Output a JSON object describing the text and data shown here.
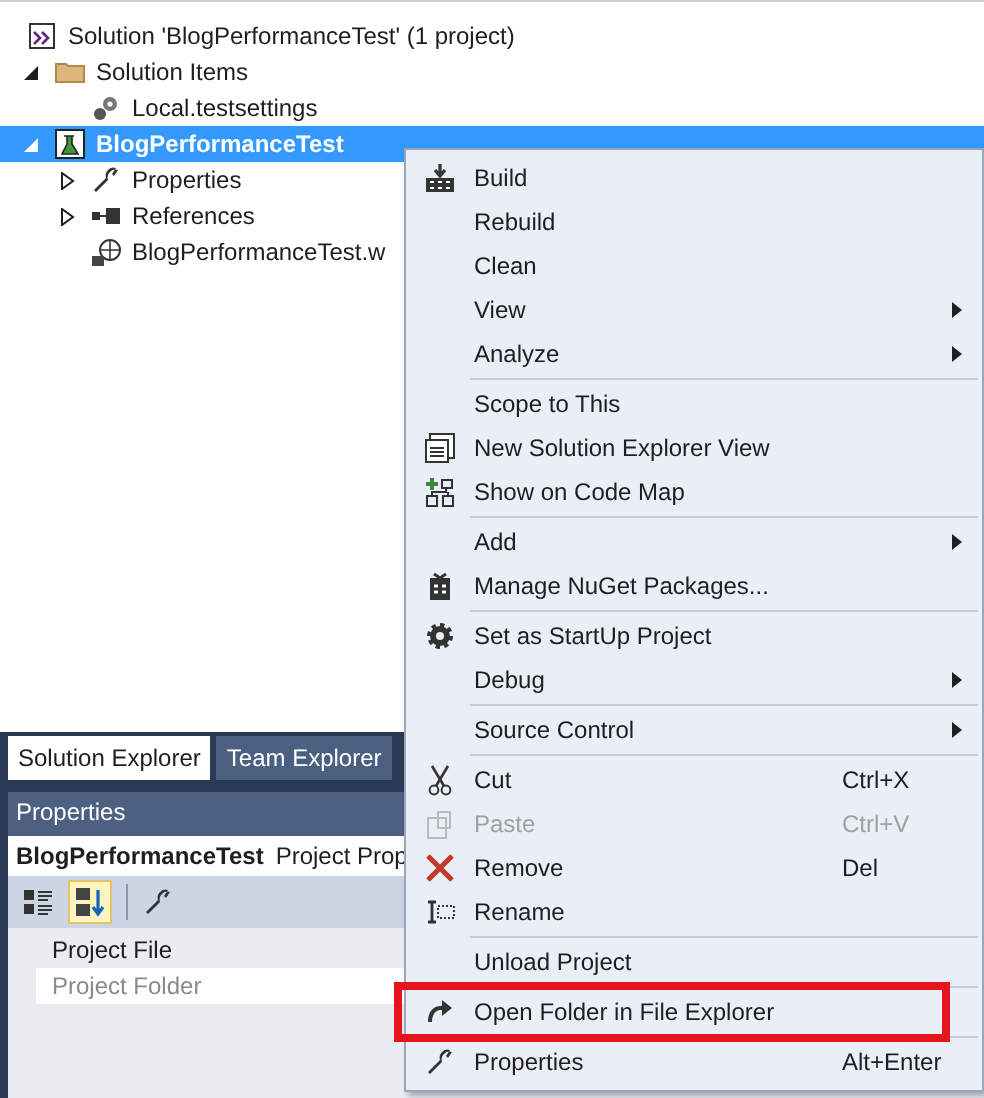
{
  "solution_explorer": {
    "tree": [
      {
        "label": "Solution 'BlogPerformanceTest' (1 project)",
        "kind": "solution",
        "selected": false,
        "children": [
          {
            "label": "Solution Items",
            "kind": "folder",
            "expanded": true,
            "selected": false,
            "children": [
              {
                "label": "Local.testsettings",
                "kind": "settings",
                "selected": false
              }
            ]
          },
          {
            "label": "BlogPerformanceTest",
            "kind": "project",
            "expanded": true,
            "selected": true,
            "children": [
              {
                "label": "Properties",
                "kind": "properties",
                "expanded": false,
                "selected": false
              },
              {
                "label": "References",
                "kind": "references",
                "expanded": false,
                "selected": false
              },
              {
                "label": "BlogPerformanceTest.w",
                "kind": "web-file",
                "selected": false
              }
            ]
          }
        ]
      }
    ]
  },
  "tabs": [
    {
      "label": "Solution Explorer",
      "selected": true
    },
    {
      "label": "Team Explorer",
      "selected": false
    }
  ],
  "properties": {
    "title": "Properties",
    "object_name": "BlogPerformanceTest",
    "object_type": "Project Prop",
    "sort_buttons": [
      {
        "selected": false
      },
      {
        "selected": true
      }
    ],
    "rows": [
      {
        "name": "Project File",
        "disabled": false
      },
      {
        "name": "Project Folder",
        "disabled": true
      }
    ]
  },
  "context_menu": {
    "items": [
      {
        "kind": "item",
        "label": "Build",
        "submenu": false,
        "disabled": false,
        "highlighted": false
      },
      {
        "kind": "item",
        "label": "Rebuild",
        "submenu": false,
        "disabled": false,
        "highlighted": false
      },
      {
        "kind": "item",
        "label": "Clean",
        "submenu": false,
        "disabled": false,
        "highlighted": false
      },
      {
        "kind": "item",
        "label": "View",
        "submenu": true,
        "disabled": false,
        "highlighted": false
      },
      {
        "kind": "item",
        "label": "Analyze",
        "submenu": true,
        "disabled": false,
        "highlighted": false
      },
      {
        "kind": "separator"
      },
      {
        "kind": "item",
        "label": "Scope to This",
        "submenu": false,
        "disabled": false,
        "highlighted": false
      },
      {
        "kind": "item",
        "label": "New Solution Explorer View",
        "submenu": false,
        "disabled": false,
        "highlighted": false
      },
      {
        "kind": "item",
        "label": "Show on Code Map",
        "submenu": false,
        "disabled": false,
        "highlighted": false
      },
      {
        "kind": "separator"
      },
      {
        "kind": "item",
        "label": "Add",
        "submenu": true,
        "disabled": false,
        "highlighted": false
      },
      {
        "kind": "item",
        "label": "Manage NuGet Packages...",
        "submenu": false,
        "disabled": false,
        "highlighted": false
      },
      {
        "kind": "separator"
      },
      {
        "kind": "item",
        "label": "Set as StartUp Project",
        "submenu": false,
        "disabled": false,
        "highlighted": false
      },
      {
        "kind": "item",
        "label": "Debug",
        "submenu": true,
        "disabled": false,
        "highlighted": false
      },
      {
        "kind": "separator"
      },
      {
        "kind": "item",
        "label": "Source Control",
        "submenu": true,
        "disabled": false,
        "highlighted": false
      },
      {
        "kind": "separator"
      },
      {
        "kind": "item",
        "label": "Cut",
        "shortcut": "Ctrl+X",
        "submenu": false,
        "disabled": false,
        "highlighted": false
      },
      {
        "kind": "item",
        "label": "Paste",
        "shortcut": "Ctrl+V",
        "submenu": false,
        "disabled": true,
        "highlighted": false
      },
      {
        "kind": "item",
        "label": "Remove",
        "shortcut": "Del",
        "submenu": false,
        "disabled": false,
        "highlighted": false
      },
      {
        "kind": "item",
        "label": "Rename",
        "submenu": false,
        "disabled": false,
        "highlighted": false
      },
      {
        "kind": "separator"
      },
      {
        "kind": "item",
        "label": "Unload Project",
        "submenu": false,
        "disabled": false,
        "highlighted": false
      },
      {
        "kind": "separator"
      },
      {
        "kind": "item",
        "label": "Open Folder in File Explorer",
        "submenu": false,
        "disabled": false,
        "highlighted": true
      },
      {
        "kind": "separator"
      },
      {
        "kind": "item",
        "label": "Properties",
        "shortcut": "Alt+Enter",
        "submenu": false,
        "disabled": false,
        "highlighted": false
      }
    ]
  }
}
